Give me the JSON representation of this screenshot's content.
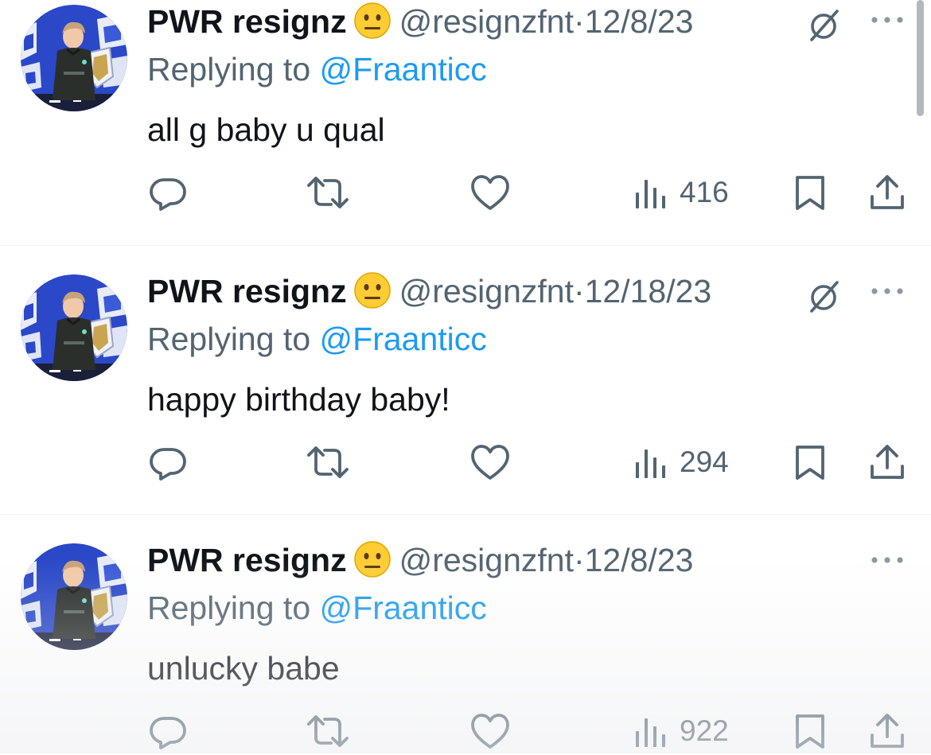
{
  "tweets": [
    {
      "display_name": "PWR resignz",
      "name_emoji": "neutral-face-emoji",
      "handle": "@resignzfnt",
      "separator": "·",
      "date": "12/8/23",
      "show_grok_icon": true,
      "replying_prefix": "Replying to",
      "replying_to": "@Fraanticc",
      "text": "all g baby u qual",
      "views": "416"
    },
    {
      "display_name": "PWR resignz",
      "name_emoji": "neutral-face-emoji",
      "handle": "@resignzfnt",
      "separator": "·",
      "date": "12/18/23",
      "show_grok_icon": true,
      "replying_prefix": "Replying to",
      "replying_to": "@Fraanticc",
      "text": "happy birthday baby!",
      "views": "294"
    },
    {
      "display_name": "PWR resignz",
      "name_emoji": "neutral-face-emoji",
      "handle": "@resignzfnt",
      "separator": "·",
      "date": "12/8/23",
      "show_grok_icon": false,
      "replying_prefix": "Replying to",
      "replying_to": "@Fraanticc",
      "text": "unlucky babe",
      "views": "922"
    }
  ],
  "icons": {
    "actions": [
      "reply-icon",
      "retweet-icon",
      "like-icon",
      "views-icon",
      "bookmark-icon",
      "share-icon"
    ],
    "header": [
      "grok-icon",
      "more-icon"
    ]
  },
  "colors": {
    "text_primary": "#0f1419",
    "text_secondary": "#536471",
    "link": "#1d9bf0",
    "divider": "#eff3f4"
  }
}
